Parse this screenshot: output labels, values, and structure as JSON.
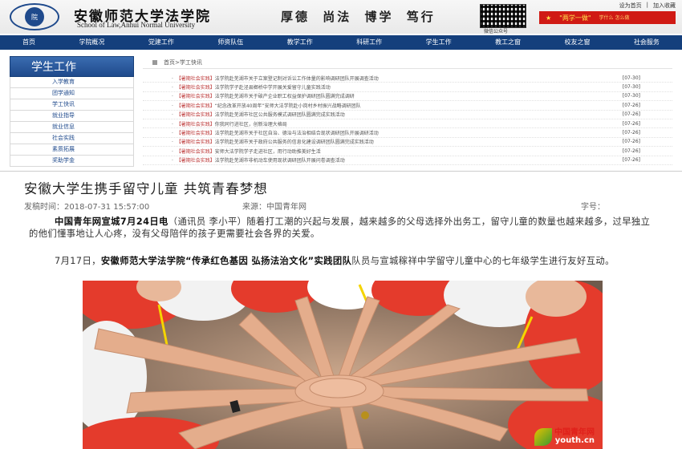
{
  "site": {
    "topbar": [
      "设为首页",
      "加入收藏"
    ],
    "logo_text": "院",
    "school_cn": "安徽师范大学法学院",
    "school_en": "School of Law,Anhui Normal University",
    "motto": [
      "厚德",
      "尚法",
      "博学",
      "笃行"
    ],
    "qr_label": "微信公众号",
    "banner": {
      "main": "\"两学一做\"",
      "side": "学什么 怎么做"
    },
    "nav": [
      "首页",
      "学院概况",
      "党建工作",
      "师资队伍",
      "教学工作",
      "科研工作",
      "学生工作",
      "教工之窗",
      "校友之窗",
      "社会服务"
    ],
    "sidebar": {
      "title": "学生工作",
      "items": [
        "入学教育",
        "团学通知",
        "学工快讯",
        "就业指导",
        "就业信息",
        "社会实践",
        "素质拓展",
        "奖助学金"
      ]
    },
    "breadcrumb": "首页>学工快讯",
    "news": [
      {
        "tag": "【暑期社会实践】",
        "title": "法学院赴芜湖市关于立案登记制对诉讼工作体量的影响调研团队开展调查活动",
        "date": "[07-30]"
      },
      {
        "tag": "【暑期社会实践】",
        "title": "法学院学子赴泾县榔桥中学开展关爱留守儿童实践活动",
        "date": "[07-30]"
      },
      {
        "tag": "【暑期社会实践】",
        "title": "法学院赴芜湖市关于破产企业职工权益保护调研团队圆满完成调研",
        "date": "[07-30]"
      },
      {
        "tag": "【暑期社会实践】",
        "title": "“纪念改革开放40周年”安师大法学院赴小岗村乡村振兴战略调研团队",
        "date": "[07-26]"
      },
      {
        "tag": "【暑期社会实践】",
        "title": "法学院赴芜湖市社区公共服务模式调研团队圆满完成实践活动",
        "date": "[07-26]"
      },
      {
        "tag": "【暑期社会实践】",
        "title": "你我同行进社区，创新治理大格局",
        "date": "[07-26]"
      },
      {
        "tag": "【暑期社会实践】",
        "title": "法学院赴芜湖市关于社区自治、德治与法治相结合现状调研团队开展调研活动",
        "date": "[07-26]"
      },
      {
        "tag": "【暑期社会实践】",
        "title": "法学院赴芜湖市关于政府公共服务的信息化建设调研团队圆满完成实践活动",
        "date": "[07-26]"
      },
      {
        "tag": "【暑期社会实践】",
        "title": "安师大法学院学子走进社区，用行动助推美好生活",
        "date": "[07-26]"
      },
      {
        "tag": "【暑期社会实践】",
        "title": "法学院赴芜湖市非机动车使用现状调研团队开展问卷调查活动",
        "date": "[07-26]"
      }
    ]
  },
  "article": {
    "title": "安徽大学生携手留守儿童 共筑青春梦想",
    "meta": {
      "date": "发稿时间：2018-07-31 15:57:00",
      "source": "来源：中国青年网",
      "fontsize": "字号："
    },
    "p1_bold": "中国青年网宣城7月24日电",
    "p1_text": "（通讯员 李小平）随着打工潮的兴起与发展，越来越多的父母选择外出务工，留守儿童的数量也越来越多，过早独立的他们懂事地让人心疼，没有父母陪伴的孩子更需要社会各界的关爱。",
    "p2_a": "7月17日，",
    "p2_bold": "安徽师范大学法学院“传承红色基因 弘扬法治文化”实践团队",
    "p2_b": "队员与宣城稼祥中学留守儿童中心的七年级学生进行友好互动。",
    "watermark": {
      "line1": "中国青年网",
      "line2": "youth.cn"
    }
  }
}
